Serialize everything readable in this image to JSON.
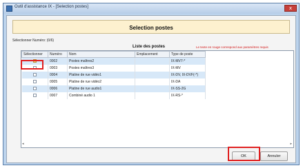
{
  "window": {
    "title": "Outil d'assistance IX - [Selection postes]",
    "close_label": "x"
  },
  "header": {
    "title": "Selection postes"
  },
  "selection_count": "Sélectionner Numéro: (0/6)",
  "list": {
    "title": "Liste des postes",
    "note": "Le texte en rouge correspond aux paramètres requis",
    "columns": [
      "Sélectionner",
      "Numéro",
      "Nom",
      "Emplacement",
      "Type de poste"
    ],
    "rows": [
      {
        "number": "0002",
        "name": "Postes maîtres2",
        "location": "",
        "type": "IX-MV7-*",
        "checked": true
      },
      {
        "number": "0003",
        "name": "Postes maîtres3",
        "location": "",
        "type": "IX-MV",
        "checked": false
      },
      {
        "number": "0004",
        "name": "Platine de rue vidéo1",
        "location": "",
        "type": "IX-DV, IX-DVF(-*)",
        "checked": false
      },
      {
        "number": "0005",
        "name": "Platine de rue vidéo2",
        "location": "",
        "type": "IX-DA",
        "checked": false
      },
      {
        "number": "0006",
        "name": "Platine de rue audio1",
        "location": "",
        "type": "IX-SS-2G",
        "checked": false
      },
      {
        "number": "0007",
        "name": "Combiné audio 1",
        "location": "",
        "type": "IX-RS-*",
        "checked": false
      }
    ]
  },
  "scroll": {
    "left_glyph": "◂",
    "right_glyph": "▸"
  },
  "buttons": {
    "ok": "OK",
    "cancel": "Annuler"
  },
  "colors": {
    "highlight_box": "#e01f1f",
    "note_text": "#d42020",
    "header_bg": "#fdf1cf"
  }
}
